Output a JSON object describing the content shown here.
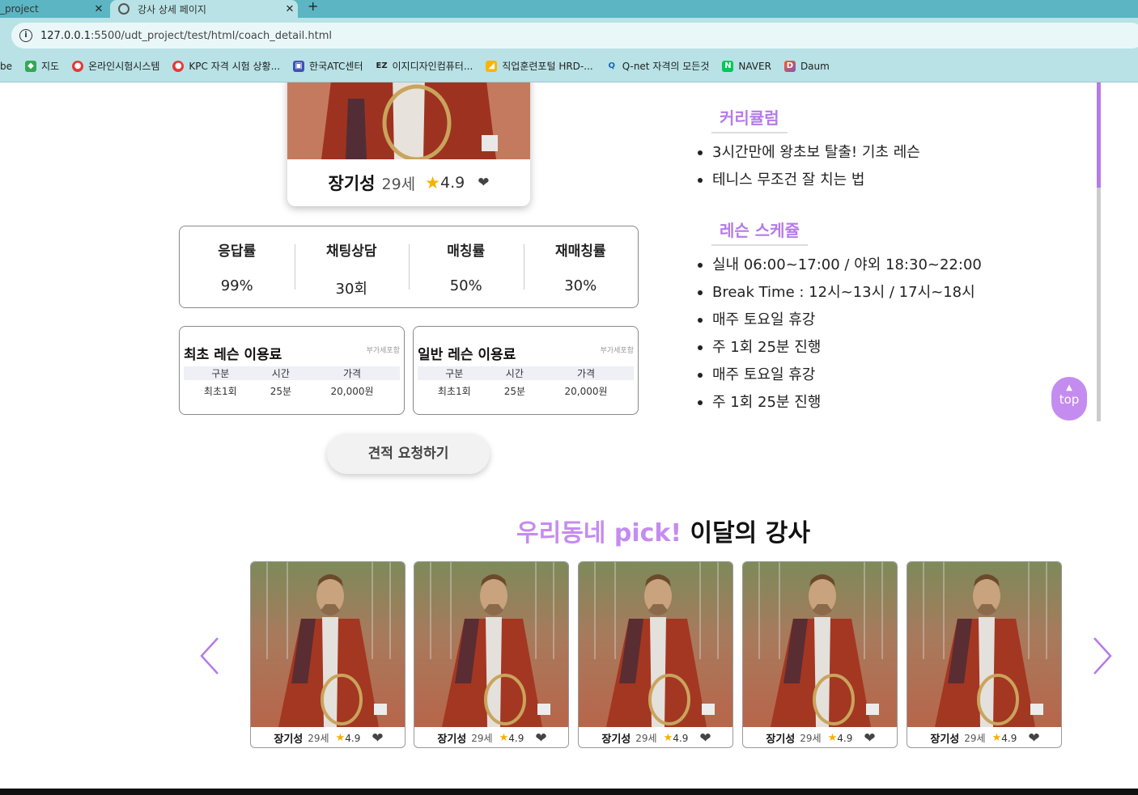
{
  "browser": {
    "tabs": [
      {
        "label": "_project",
        "active": false
      },
      {
        "label": "강사 상세 페이지",
        "active": true
      }
    ],
    "url_host": "127.0.0.1",
    "url_rest": ":5500/udt_project/test/html/coach_detail.html",
    "bookmarks": [
      {
        "label": "be",
        "icon": "bookmark-icon"
      },
      {
        "label": "지도",
        "icon": "maps-icon"
      },
      {
        "label": "온라인시험시스템",
        "icon": "exam-icon"
      },
      {
        "label": "KPC 자격 시험 상황...",
        "icon": "kpc-icon"
      },
      {
        "label": "한국ATC센터",
        "icon": "atc-icon"
      },
      {
        "label": "이지디자인컴퓨터...",
        "icon": "ez-icon"
      },
      {
        "label": "직업훈련포털 HRD-...",
        "icon": "hrd-icon"
      },
      {
        "label": "Q-net 자격의 모든것",
        "icon": "qnet-icon"
      },
      {
        "label": "NAVER",
        "icon": "naver-icon"
      },
      {
        "label": "Daum",
        "icon": "daum-icon"
      }
    ]
  },
  "coach": {
    "name": "장기성",
    "age": "29세",
    "rating": "4.9"
  },
  "stats": [
    {
      "label": "응답률",
      "value": "99%"
    },
    {
      "label": "채팅상담",
      "value": "30회"
    },
    {
      "label": "매칭률",
      "value": "50%"
    },
    {
      "label": "재매칭률",
      "value": "30%"
    }
  ],
  "prices": [
    {
      "title": "최초 레슨 이용료",
      "note": "부가세포함",
      "headers": [
        "구분",
        "시간",
        "가격"
      ],
      "row": [
        "최초1회",
        "25분",
        "20,000원"
      ]
    },
    {
      "title": "일반 레슨 이용료",
      "note": "부가세포함",
      "headers": [
        "구분",
        "시간",
        "가격"
      ],
      "row": [
        "최초1회",
        "25분",
        "20,000원"
      ]
    }
  ],
  "quote_button": "견적 요청하기",
  "curriculum": {
    "title": "커리큘럼",
    "items": [
      "3시간만에 왕초보 탈출! 기초 레슨",
      "테니스 무조건 잘 치는 법"
    ]
  },
  "schedule": {
    "title": "레슨 스케쥴",
    "items": [
      "실내 06:00~17:00 / 야외 18:30~22:00",
      "Break Time : 12시~13시 / 17시~18시",
      "매주 토요일 휴강",
      "주 1회 25분 진행",
      "매주 토요일 휴강",
      "주 1회 25분 진행"
    ]
  },
  "top_button": "top",
  "pick": {
    "accent": "우리동네 pick!",
    "rest": "이달의 강사",
    "cards": [
      {
        "name": "장기성",
        "age": "29세",
        "rating": "4.9"
      },
      {
        "name": "장기성",
        "age": "29세",
        "rating": "4.9"
      },
      {
        "name": "장기성",
        "age": "29세",
        "rating": "4.9"
      },
      {
        "name": "장기성",
        "age": "29세",
        "rating": "4.9"
      },
      {
        "name": "장기성",
        "age": "29세",
        "rating": "4.9"
      }
    ]
  },
  "colors": {
    "accent": "#c58cf0",
    "tab_bar": "#5bb5c2",
    "toolbar": "#b8e2e6",
    "star": "#f5b000"
  }
}
